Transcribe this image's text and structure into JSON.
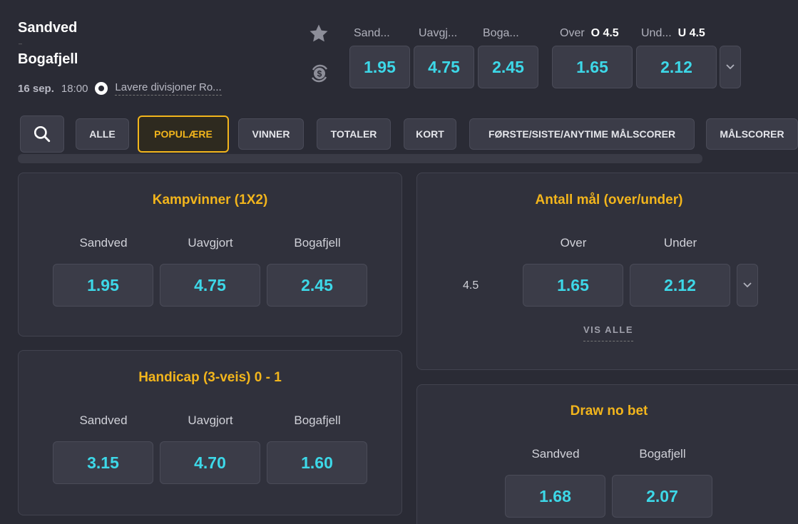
{
  "match": {
    "home": "Sandved",
    "away": "Bogafjell",
    "date": "16 sep.",
    "time": "18:00",
    "league": "Lavere divisjoner Ro..."
  },
  "header_market": {
    "labels": [
      "Sand...",
      "Uavgj...",
      "Boga..."
    ],
    "odds": [
      "1.95",
      "4.75",
      "2.45"
    ],
    "total_over_label": "Over",
    "total_over_line": "O 4.5",
    "total_under_label": "Und...",
    "total_under_line": "U 4.5",
    "total_odds": [
      "1.65",
      "2.12"
    ]
  },
  "filters": {
    "items": [
      "ALLE",
      "POPULÆRE",
      "VINNER",
      "TOTALER",
      "KORT",
      "FØRSTE/SISTE/ANYTIME MÅLSCORER",
      "MÅLSCORER"
    ],
    "active_index": 1
  },
  "markets": {
    "kampvinner": {
      "title": "Kampvinner (1X2)",
      "labels": [
        "Sandved",
        "Uavgjort",
        "Bogafjell"
      ],
      "odds": [
        "1.95",
        "4.75",
        "2.45"
      ]
    },
    "antall_mal": {
      "title": "Antall mål (over/under)",
      "labels": [
        "Over",
        "Under"
      ],
      "line": "4.5",
      "odds": [
        "1.65",
        "2.12"
      ],
      "vis_alle": "VIS ALLE"
    },
    "handicap": {
      "title": "Handicap (3-veis) 0 - 1",
      "labels": [
        "Sandved",
        "Uavgjort",
        "Bogafjell"
      ],
      "odds": [
        "3.15",
        "4.70",
        "1.60"
      ]
    },
    "draw_no_bet": {
      "title": "Draw no bet",
      "labels": [
        "Sandved",
        "Bogafjell"
      ],
      "odds": [
        "1.68",
        "2.07"
      ]
    }
  },
  "icons": {
    "favorite": "star-icon",
    "cashout": "cashout-icon",
    "search": "search-icon",
    "expand": "chevron-down-icon",
    "sport": "soccer-ball-icon"
  },
  "colors": {
    "accent": "#f2b51c",
    "odds": "#3dd8e8",
    "background": "#2a2b35"
  }
}
